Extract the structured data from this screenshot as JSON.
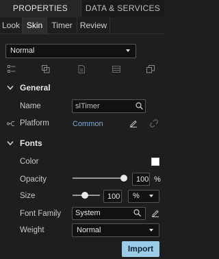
{
  "main_tabs": [
    {
      "label": "PROPERTIES",
      "active": true
    },
    {
      "label": "DATA & SERVICES",
      "active": false
    }
  ],
  "sub_tabs": [
    {
      "label": "Look",
      "active": false
    },
    {
      "label": "Skin",
      "active": true
    },
    {
      "label": "Timer",
      "active": false
    },
    {
      "label": "Review",
      "active": false
    }
  ],
  "skin_select": {
    "value": "Normal"
  },
  "toolbar": {
    "icons": [
      "list-icon",
      "copy-icon",
      "paste-icon",
      "table-icon",
      "duplicate-icon"
    ]
  },
  "general": {
    "title": "General",
    "name_label": "Name",
    "name_value": "slTimer",
    "platform_label": "Platform",
    "platform_value": "Common"
  },
  "fonts": {
    "title": "Fonts",
    "color_label": "Color",
    "color_value": "#ffffff",
    "opacity_label": "Opacity",
    "opacity_value": "100",
    "opacity_unit": "%",
    "opacity_fraction": 1.0,
    "size_label": "Size",
    "size_value": "100",
    "size_unit": "%",
    "size_fraction": 0.2,
    "family_label": "Font Family",
    "family_value": "System",
    "weight_label": "Weight",
    "weight_value": "Normal"
  },
  "import_button": "Import",
  "colors": {
    "accent": "#9ccbe8",
    "link": "#7fa9d9",
    "background": "#1e1e1e"
  }
}
